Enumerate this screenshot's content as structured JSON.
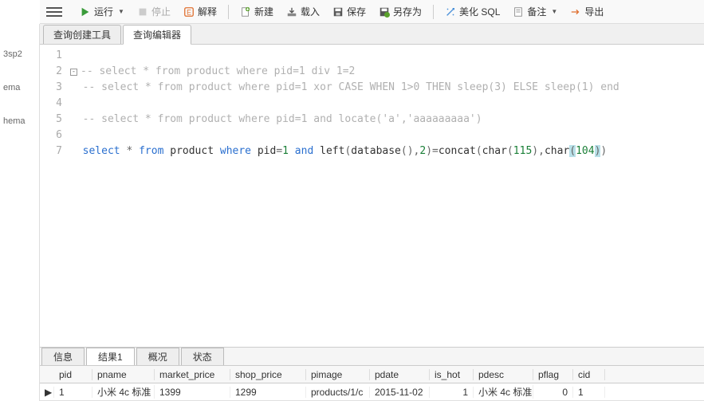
{
  "toolbar": {
    "run": "运行",
    "stop": "停止",
    "explain": "解释",
    "new": "新建",
    "load": "载入",
    "save": "保存",
    "saveas": "另存为",
    "beautify": "美化 SQL",
    "remark": "备注",
    "export": "导出"
  },
  "tree": {
    "item1": "3sp2",
    "item2": "ema",
    "item3": "hema"
  },
  "tabs_upper": {
    "builder": "查询创建工具",
    "editor": "查询编辑器"
  },
  "code": {
    "l2": "-- select * from product where pid=1 div 1=2",
    "l3": "-- select * from product where pid=1 xor CASE WHEN 1>0 THEN sleep(3) ELSE sleep(1) end",
    "l5": "-- select * from product where pid=1 and locate('a','aaaaaaaaa')",
    "l7": {
      "select": "select",
      "star": " * ",
      "from": "from",
      "product": " product ",
      "where": "where",
      "pid": " pid",
      "eq": "=",
      "one": "1",
      "and": " and ",
      "left": "left",
      "p1": "(",
      "database": "database",
      "p2": "(),",
      "two": "2",
      "p3": ")=",
      "concat": "concat",
      "p4": "(",
      "char1": "char",
      "p5": "(",
      "n115": "115",
      "p6": "),",
      "char2": "char",
      "p7": "(",
      "n104": "104",
      "p8": ")",
      "p9": ")"
    }
  },
  "result_tabs": {
    "info": "信息",
    "result1": "结果1",
    "overview": "概况",
    "status": "状态"
  },
  "columns": {
    "pid": "pid",
    "pname": "pname",
    "market_price": "market_price",
    "shop_price": "shop_price",
    "pimage": "pimage",
    "pdate": "pdate",
    "is_hot": "is_hot",
    "pdesc": "pdesc",
    "pflag": "pflag",
    "cid": "cid"
  },
  "row1": {
    "pid": "1",
    "pname": "小米 4c 标准",
    "market_price": "1399",
    "shop_price": "1299",
    "pimage": "products/1/c",
    "pdate": "2015-11-02",
    "is_hot": "1",
    "pdesc": "小米 4c 标准",
    "pflag": "0",
    "cid": "1"
  }
}
